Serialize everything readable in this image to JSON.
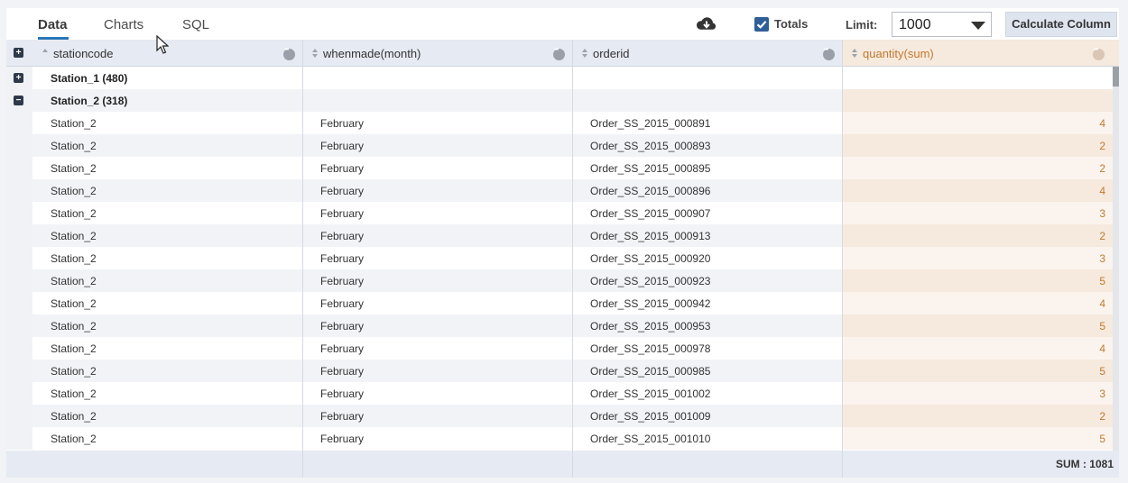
{
  "tabs": [
    {
      "label": "Data",
      "active": true
    },
    {
      "label": "Charts",
      "active": false
    },
    {
      "label": "SQL",
      "active": false
    }
  ],
  "toolbar": {
    "download_icon": "cloud-download-icon",
    "totals_label": "Totals",
    "totals_checked": true,
    "limit_label": "Limit:",
    "limit_value": "1000",
    "calculate_label": "Calculate Column"
  },
  "columns": [
    {
      "name": "stationcode"
    },
    {
      "name": "whenmade(month)"
    },
    {
      "name": "orderid"
    },
    {
      "name": "quantity(sum)"
    }
  ],
  "groups": [
    {
      "label": "Station_1 (480)",
      "expanded": false
    },
    {
      "label": "Station_2 (318)",
      "expanded": true
    }
  ],
  "rows": [
    {
      "station": "Station_2",
      "month": "February",
      "order": "Order_SS_2015_000891",
      "qty": "4"
    },
    {
      "station": "Station_2",
      "month": "February",
      "order": "Order_SS_2015_000893",
      "qty": "2"
    },
    {
      "station": "Station_2",
      "month": "February",
      "order": "Order_SS_2015_000895",
      "qty": "2"
    },
    {
      "station": "Station_2",
      "month": "February",
      "order": "Order_SS_2015_000896",
      "qty": "4"
    },
    {
      "station": "Station_2",
      "month": "February",
      "order": "Order_SS_2015_000907",
      "qty": "3"
    },
    {
      "station": "Station_2",
      "month": "February",
      "order": "Order_SS_2015_000913",
      "qty": "2"
    },
    {
      "station": "Station_2",
      "month": "February",
      "order": "Order_SS_2015_000920",
      "qty": "3"
    },
    {
      "station": "Station_2",
      "month": "February",
      "order": "Order_SS_2015_000923",
      "qty": "5"
    },
    {
      "station": "Station_2",
      "month": "February",
      "order": "Order_SS_2015_000942",
      "qty": "4"
    },
    {
      "station": "Station_2",
      "month": "February",
      "order": "Order_SS_2015_000953",
      "qty": "5"
    },
    {
      "station": "Station_2",
      "month": "February",
      "order": "Order_SS_2015_000978",
      "qty": "4"
    },
    {
      "station": "Station_2",
      "month": "February",
      "order": "Order_SS_2015_000985",
      "qty": "5"
    },
    {
      "station": "Station_2",
      "month": "February",
      "order": "Order_SS_2015_001002",
      "qty": "3"
    },
    {
      "station": "Station_2",
      "month": "February",
      "order": "Order_SS_2015_001009",
      "qty": "2"
    },
    {
      "station": "Station_2",
      "month": "February",
      "order": "Order_SS_2015_001010",
      "qty": "5"
    }
  ],
  "footer": {
    "sum_label": "SUM : 1081"
  },
  "colors": {
    "accent": "#2a77b8",
    "quantity_text": "#c07a30",
    "quantity_bg": "#f6e9dd",
    "checkbox": "#2f5f98"
  }
}
